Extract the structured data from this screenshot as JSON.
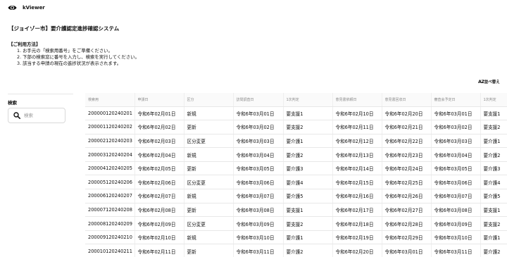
{
  "app": {
    "name": "kViewer"
  },
  "page": {
    "title": "【ジョイゾー市】要介護認定進捗確認システム"
  },
  "usage": {
    "heading": "【ご利用方法】",
    "steps": [
      "1. お手元の「検索用番号」をご準備ください。",
      "2. 下部の検索窓に番号を入力し、検索を実行してください。",
      "3. 該当する申請の現在の進捗状況が表示されます。"
    ]
  },
  "toolbar": {
    "sort_az": "AZ",
    "sort_label": "並べ替え"
  },
  "search": {
    "label": "検索",
    "placeholder": "検索",
    "value": ""
  },
  "table": {
    "columns": [
      "検索用",
      "申請日",
      "区分",
      "訪問調査日",
      "1次判定",
      "意見書依頼日",
      "意見書回収日",
      "審査会予定日",
      "1次判定"
    ],
    "rows": [
      [
        "200000120240201",
        "令和6年02月01日",
        "新規",
        "令和6年03月01日",
        "要支援1",
        "令和6年02月10日",
        "令和6年02月20日",
        "令和6年03月01日",
        "要支援1"
      ],
      [
        "200001120240202",
        "令和6年02月02日",
        "更新",
        "令和6年03月02日",
        "要支援2",
        "令和6年02月11日",
        "令和6年02月21日",
        "令和6年03月02日",
        "要支援2"
      ],
      [
        "200002120240203",
        "令和6年02月03日",
        "区分変更",
        "令和6年03月03日",
        "要介護1",
        "令和6年02月12日",
        "令和6年02月22日",
        "令和6年03月03日",
        "要介護1"
      ],
      [
        "200003120240204",
        "令和6年02月04日",
        "新規",
        "令和6年03月04日",
        "要介護2",
        "令和6年02月13日",
        "令和6年02月23日",
        "令和6年03月04日",
        "要介護2"
      ],
      [
        "200004120240205",
        "令和6年02月05日",
        "更新",
        "令和6年03月05日",
        "要介護3",
        "令和6年02月14日",
        "令和6年02月24日",
        "令和6年03月05日",
        "要介護3"
      ],
      [
        "200005120240206",
        "令和6年02月06日",
        "区分変更",
        "令和6年03月06日",
        "要介護4",
        "令和6年02月15日",
        "令和6年02月25日",
        "令和6年03月06日",
        "要介護4"
      ],
      [
        "200006120240207",
        "令和6年02月07日",
        "新規",
        "令和6年03月07日",
        "要介護5",
        "令和6年02月16日",
        "令和6年02月26日",
        "令和6年03月07日",
        "要介護5"
      ],
      [
        "200007120240208",
        "令和6年02月08日",
        "更新",
        "令和6年03月08日",
        "要支援1",
        "令和6年02月17日",
        "令和6年02月27日",
        "令和6年03月08日",
        "要支援1"
      ],
      [
        "200008120240209",
        "令和6年02月09日",
        "区分変更",
        "令和6年03月09日",
        "要支援2",
        "令和6年02月18日",
        "令和6年02月28日",
        "令和6年03月09日",
        "要支援2"
      ],
      [
        "200009120240210",
        "令和6年02月10日",
        "新規",
        "令和6年03月10日",
        "要介護1",
        "令和6年02月19日",
        "令和6年02月29日",
        "令和6年03月10日",
        "要介護1"
      ],
      [
        "200010120240211",
        "令和6年02月11日",
        "更新",
        "令和6年03月11日",
        "要介護2",
        "令和6年02月20日",
        "令和6年03月01日",
        "令和6年03月11日",
        "要介護2"
      ]
    ]
  },
  "icons": {
    "logo": "eye-logo-icon",
    "search": "search-icon"
  },
  "colors": {
    "text": "#111111",
    "header_text": "#888888",
    "border": "#e8e8e8",
    "header_bg": "#fafafa"
  }
}
